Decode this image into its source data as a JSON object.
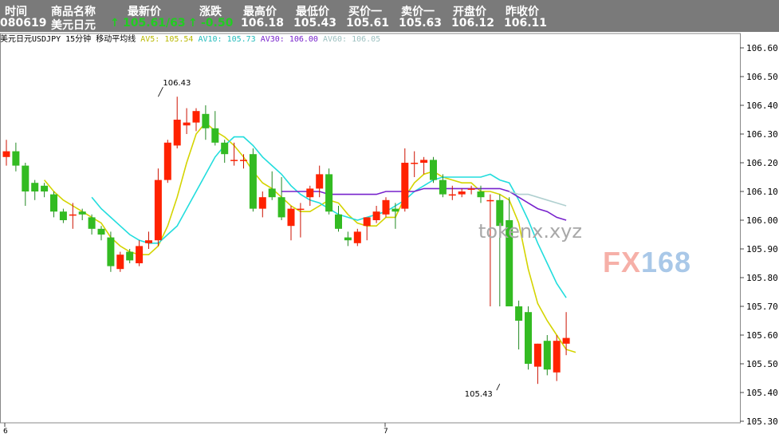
{
  "header": {
    "labels": [
      "时间",
      "商品名称",
      "最新价",
      "涨跌",
      "最高价",
      "最低价",
      "买价一",
      "卖价一",
      "开盘价",
      "昨收价"
    ],
    "time": "080619",
    "name": "美元日元",
    "last": "105.61/63",
    "change": "-0.50",
    "high": "106.18",
    "low": "105.43",
    "bid": "105.61",
    "ask": "105.63",
    "open": "106.12",
    "prev_close": "106.11",
    "arrow": "↑"
  },
  "subtitle": {
    "instrument": "美元日元USDJPY 15分钟 移动平均线",
    "av5": "AV5: 105.54",
    "av10": "AV10: 105.73",
    "av30": "AV30: 106.00",
    "av60": "AV60: 106.05"
  },
  "watermark": {
    "site": "tokenx.xyz",
    "logo_a": "FX",
    "logo_b": "168"
  },
  "colors": {
    "up": "#ff2200",
    "down": "#33bb22",
    "av5": "#d4d400",
    "av10": "#22dddd",
    "av30": "#7722cc",
    "av60": "#b0d0d0"
  },
  "chart_data": {
    "type": "candlestick",
    "y_ticks": [
      "106.60",
      "106.50",
      "106.40",
      "106.30",
      "106.20",
      "106.10",
      "106.00",
      "105.90",
      "105.80",
      "105.70",
      "105.60",
      "105.50",
      "105.40",
      "105.30"
    ],
    "ylim": [
      105.3,
      106.65
    ],
    "x_ticks": [
      "6",
      "7"
    ],
    "annotations": [
      {
        "label": "106.43",
        "value": 106.43,
        "index": 16
      },
      {
        "label": "105.43",
        "value": 105.43,
        "index": 52
      }
    ],
    "candles": [
      {
        "o": 106.22,
        "h": 106.28,
        "l": 106.19,
        "c": 106.24
      },
      {
        "o": 106.24,
        "h": 106.27,
        "l": 106.17,
        "c": 106.19
      },
      {
        "o": 106.19,
        "h": 106.2,
        "l": 106.05,
        "c": 106.1
      },
      {
        "o": 106.13,
        "h": 106.14,
        "l": 106.07,
        "c": 106.1
      },
      {
        "o": 106.12,
        "h": 106.13,
        "l": 106.08,
        "c": 106.1
      },
      {
        "o": 106.09,
        "h": 106.1,
        "l": 106.01,
        "c": 106.03
      },
      {
        "o": 106.03,
        "h": 106.04,
        "l": 105.99,
        "c": 106.0
      },
      {
        "o": 106.02,
        "h": 106.06,
        "l": 105.97,
        "c": 106.02
      },
      {
        "o": 106.03,
        "h": 106.04,
        "l": 106.0,
        "c": 106.02
      },
      {
        "o": 106.01,
        "h": 106.02,
        "l": 105.95,
        "c": 105.97
      },
      {
        "o": 105.97,
        "h": 105.98,
        "l": 105.93,
        "c": 105.95
      },
      {
        "o": 105.94,
        "h": 105.96,
        "l": 105.82,
        "c": 105.84
      },
      {
        "o": 105.83,
        "h": 105.89,
        "l": 105.82,
        "c": 105.88
      },
      {
        "o": 105.89,
        "h": 105.9,
        "l": 105.85,
        "c": 105.86
      },
      {
        "o": 105.85,
        "h": 105.93,
        "l": 105.84,
        "c": 105.91
      },
      {
        "o": 105.92,
        "h": 105.96,
        "l": 105.9,
        "c": 105.93
      },
      {
        "o": 105.93,
        "h": 106.18,
        "l": 105.91,
        "c": 106.14
      },
      {
        "o": 106.14,
        "h": 106.28,
        "l": 106.13,
        "c": 106.27
      },
      {
        "o": 106.26,
        "h": 106.43,
        "l": 106.25,
        "c": 106.35
      },
      {
        "o": 106.33,
        "h": 106.39,
        "l": 106.3,
        "c": 106.34
      },
      {
        "o": 106.34,
        "h": 106.39,
        "l": 106.31,
        "c": 106.38
      },
      {
        "o": 106.37,
        "h": 106.4,
        "l": 106.28,
        "c": 106.32
      },
      {
        "o": 106.32,
        "h": 106.38,
        "l": 106.26,
        "c": 106.27
      },
      {
        "o": 106.27,
        "h": 106.28,
        "l": 106.2,
        "c": 106.23
      },
      {
        "o": 106.21,
        "h": 106.27,
        "l": 106.19,
        "c": 106.21
      },
      {
        "o": 106.21,
        "h": 106.23,
        "l": 106.18,
        "c": 106.21
      },
      {
        "o": 106.23,
        "h": 106.25,
        "l": 106.03,
        "c": 106.04
      },
      {
        "o": 106.04,
        "h": 106.1,
        "l": 106.01,
        "c": 106.08
      },
      {
        "o": 106.11,
        "h": 106.17,
        "l": 106.07,
        "c": 106.08
      },
      {
        "o": 106.08,
        "h": 106.15,
        "l": 106.0,
        "c": 106.01
      },
      {
        "o": 105.98,
        "h": 106.05,
        "l": 105.93,
        "c": 106.04
      },
      {
        "o": 106.04,
        "h": 106.06,
        "l": 105.94,
        "c": 106.04
      },
      {
        "o": 106.08,
        "h": 106.12,
        "l": 106.05,
        "c": 106.11
      },
      {
        "o": 106.11,
        "h": 106.19,
        "l": 106.08,
        "c": 106.16
      },
      {
        "o": 106.16,
        "h": 106.18,
        "l": 106.02,
        "c": 106.03
      },
      {
        "o": 106.02,
        "h": 106.05,
        "l": 105.96,
        "c": 105.97
      },
      {
        "o": 105.94,
        "h": 105.96,
        "l": 105.91,
        "c": 105.93
      },
      {
        "o": 105.92,
        "h": 105.97,
        "l": 105.91,
        "c": 105.96
      },
      {
        "o": 105.98,
        "h": 106.0,
        "l": 105.93,
        "c": 106.01
      },
      {
        "o": 106.0,
        "h": 106.05,
        "l": 105.99,
        "c": 106.03
      },
      {
        "o": 106.02,
        "h": 106.08,
        "l": 106.01,
        "c": 106.07
      },
      {
        "o": 106.04,
        "h": 106.06,
        "l": 105.97,
        "c": 106.03
      },
      {
        "o": 106.04,
        "h": 106.25,
        "l": 106.03,
        "c": 106.2
      },
      {
        "o": 106.2,
        "h": 106.24,
        "l": 106.15,
        "c": 106.2
      },
      {
        "o": 106.2,
        "h": 106.22,
        "l": 106.16,
        "c": 106.21
      },
      {
        "o": 106.21,
        "h": 106.22,
        "l": 106.13,
        "c": 106.14
      },
      {
        "o": 106.14,
        "h": 106.16,
        "l": 106.08,
        "c": 106.09
      },
      {
        "o": 106.09,
        "h": 106.12,
        "l": 106.07,
        "c": 106.09
      },
      {
        "o": 106.09,
        "h": 106.11,
        "l": 106.08,
        "c": 106.1
      },
      {
        "o": 106.11,
        "h": 106.12,
        "l": 106.09,
        "c": 106.11
      },
      {
        "o": 106.1,
        "h": 106.12,
        "l": 106.06,
        "c": 106.08
      },
      {
        "o": 106.07,
        "h": 106.09,
        "l": 105.7,
        "c": 106.07
      },
      {
        "o": 106.07,
        "h": 106.09,
        "l": 105.7,
        "c": 105.98
      },
      {
        "o": 106.0,
        "h": 106.08,
        "l": 105.7,
        "c": 105.7
      },
      {
        "o": 105.7,
        "h": 105.72,
        "l": 105.55,
        "c": 105.65
      },
      {
        "o": 105.68,
        "h": 105.7,
        "l": 105.48,
        "c": 105.5
      },
      {
        "o": 105.49,
        "h": 105.57,
        "l": 105.43,
        "c": 105.57
      },
      {
        "o": 105.58,
        "h": 105.6,
        "l": 105.46,
        "c": 105.48
      },
      {
        "o": 105.47,
        "h": 105.6,
        "l": 105.44,
        "c": 105.58
      },
      {
        "o": 105.57,
        "h": 105.68,
        "l": 105.53,
        "c": 105.59
      }
    ],
    "series": [
      {
        "name": "AV5",
        "values": [
          null,
          null,
          null,
          null,
          106.14,
          106.1,
          106.07,
          106.05,
          106.03,
          106.01,
          105.99,
          105.94,
          105.91,
          105.89,
          105.88,
          105.88,
          105.91,
          105.98,
          106.08,
          106.2,
          106.3,
          106.34,
          106.31,
          106.29,
          106.26,
          106.22,
          106.17,
          106.13,
          106.11,
          106.08,
          106.05,
          106.03,
          106.03,
          106.05,
          106.07,
          106.06,
          106.02,
          105.99,
          105.98,
          105.98,
          106.01,
          106.01,
          106.08,
          106.13,
          106.16,
          106.17,
          106.15,
          106.14,
          106.13,
          106.13,
          106.1,
          106.1,
          106.09,
          106.07,
          105.99,
          105.83,
          105.71,
          105.65,
          105.6,
          105.55,
          105.54
        ]
      },
      {
        "name": "AV10",
        "values": [
          null,
          null,
          null,
          null,
          null,
          null,
          null,
          null,
          null,
          106.08,
          106.04,
          106.01,
          105.98,
          105.95,
          105.93,
          105.92,
          105.92,
          105.95,
          105.98,
          106.04,
          106.1,
          106.16,
          106.22,
          106.26,
          106.29,
          106.29,
          106.26,
          106.22,
          106.19,
          106.16,
          106.12,
          106.09,
          106.07,
          106.06,
          106.04,
          106.02,
          106.01,
          106.0,
          106.01,
          106.02,
          106.03,
          106.05,
          106.07,
          106.1,
          106.12,
          106.14,
          106.15,
          106.15,
          106.15,
          106.15,
          106.15,
          106.16,
          106.14,
          106.13,
          106.07,
          106.0,
          105.92,
          105.85,
          105.78,
          105.73
        ]
      },
      {
        "name": "AV30",
        "values": [
          null,
          null,
          null,
          null,
          null,
          null,
          null,
          null,
          null,
          null,
          null,
          null,
          null,
          null,
          null,
          null,
          null,
          null,
          null,
          null,
          null,
          null,
          null,
          null,
          null,
          null,
          null,
          null,
          null,
          106.1,
          106.1,
          106.1,
          106.1,
          106.1,
          106.09,
          106.09,
          106.09,
          106.09,
          106.09,
          106.09,
          106.1,
          106.1,
          106.1,
          106.1,
          106.11,
          106.11,
          106.11,
          106.11,
          106.11,
          106.11,
          106.11,
          106.11,
          106.11,
          106.1,
          106.08,
          106.06,
          106.04,
          106.03,
          106.01,
          106.0
        ]
      },
      {
        "name": "AV60",
        "values": [
          null,
          null,
          null,
          null,
          null,
          null,
          null,
          null,
          null,
          null,
          null,
          null,
          null,
          null,
          null,
          null,
          null,
          null,
          null,
          null,
          null,
          null,
          null,
          null,
          null,
          null,
          null,
          null,
          null,
          null,
          null,
          null,
          null,
          null,
          null,
          null,
          null,
          null,
          null,
          null,
          null,
          null,
          null,
          null,
          null,
          null,
          null,
          null,
          null,
          null,
          null,
          null,
          null,
          106.1,
          106.09,
          106.09,
          106.08,
          106.07,
          106.06,
          106.05
        ]
      }
    ]
  }
}
